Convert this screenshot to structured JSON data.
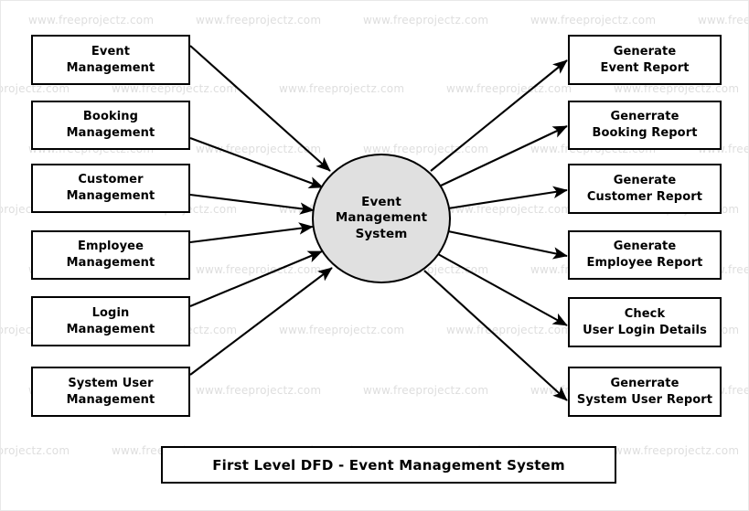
{
  "diagram": {
    "title": "First Level DFD - Event Management System",
    "watermark_text": "www.freeprojectz.com",
    "colors": {
      "process_fill": "#e0e0e0",
      "stroke": "#000000",
      "entity_fill": "#ffffff",
      "watermark": "#dedede",
      "page_background": "#ffffff"
    },
    "process": {
      "name": "event-management-system",
      "line1": "Event",
      "line2": "Management",
      "line3": "System"
    },
    "inputs": [
      {
        "line1": "Event",
        "line2": "Management"
      },
      {
        "line1": "Booking",
        "line2": "Management"
      },
      {
        "line1": "Customer",
        "line2": "Management"
      },
      {
        "line1": "Employee",
        "line2": "Management"
      },
      {
        "line1": "Login",
        "line2": "Management"
      },
      {
        "line1": "System User",
        "line2": "Management"
      }
    ],
    "outputs": [
      {
        "line1": "Generate",
        "line2": "Event Report"
      },
      {
        "line1": "Generrate",
        "line2": "Booking Report"
      },
      {
        "line1": "Generate",
        "line2": "Customer Report"
      },
      {
        "line1": "Generate",
        "line2": "Employee Report"
      },
      {
        "line1": "Check",
        "line2": "User Login Details"
      },
      {
        "line1": "Generrate",
        "line2": "System User Report"
      }
    ]
  }
}
